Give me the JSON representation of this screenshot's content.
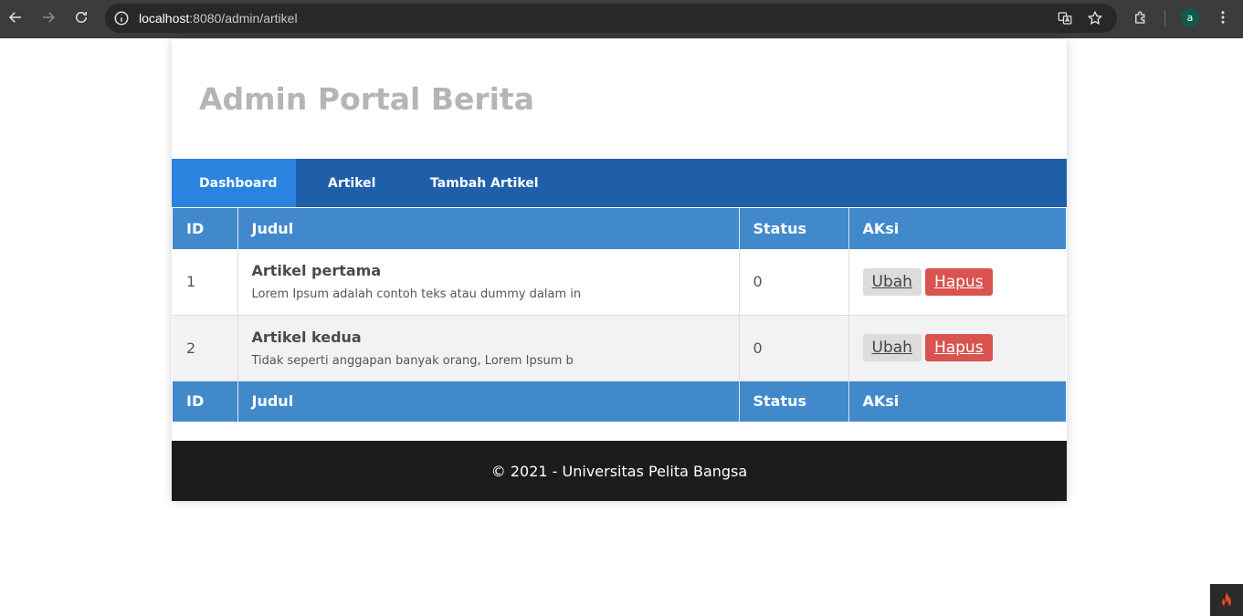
{
  "browser": {
    "url_host": "localhost",
    "url_path": ":8080/admin/artikel",
    "avatar_letter": "a"
  },
  "header": {
    "title": "Admin Portal Berita"
  },
  "nav": {
    "items": [
      {
        "label": "Dashboard",
        "active": true
      },
      {
        "label": "Artikel",
        "active": false
      },
      {
        "label": "Tambah Artikel",
        "active": false
      }
    ]
  },
  "table": {
    "headers": [
      "ID",
      "Judul",
      "Status",
      "AKsi"
    ],
    "rows": [
      {
        "id": "1",
        "title": "Artikel pertama",
        "excerpt": "Lorem Ipsum adalah contoh teks atau dummy dalam in",
        "status": "0",
        "edit": "Ubah",
        "delete": "Hapus"
      },
      {
        "id": "2",
        "title": "Artikel kedua",
        "excerpt": "Tidak seperti anggapan banyak orang, Lorem Ipsum b",
        "status": "0",
        "edit": "Ubah",
        "delete": "Hapus"
      }
    ],
    "footer_headers": [
      "ID",
      "Judul",
      "Status",
      "AKsi"
    ]
  },
  "footer": {
    "text": "© 2021 - Universitas Pelita Bangsa"
  },
  "colors": {
    "nav_bg": "#1f5faa",
    "nav_active": "#2b83e0",
    "table_header": "#4189cb",
    "delete_button": "#d9534f",
    "footer_bg": "#1c1c1c"
  },
  "icons": [
    "back-arrow-icon",
    "forward-arrow-icon",
    "reload-icon",
    "site-info-icon",
    "translate-icon",
    "bookmark-star-icon",
    "extensions-icon",
    "menu-dots-icon",
    "codeigniter-flame-icon"
  ]
}
